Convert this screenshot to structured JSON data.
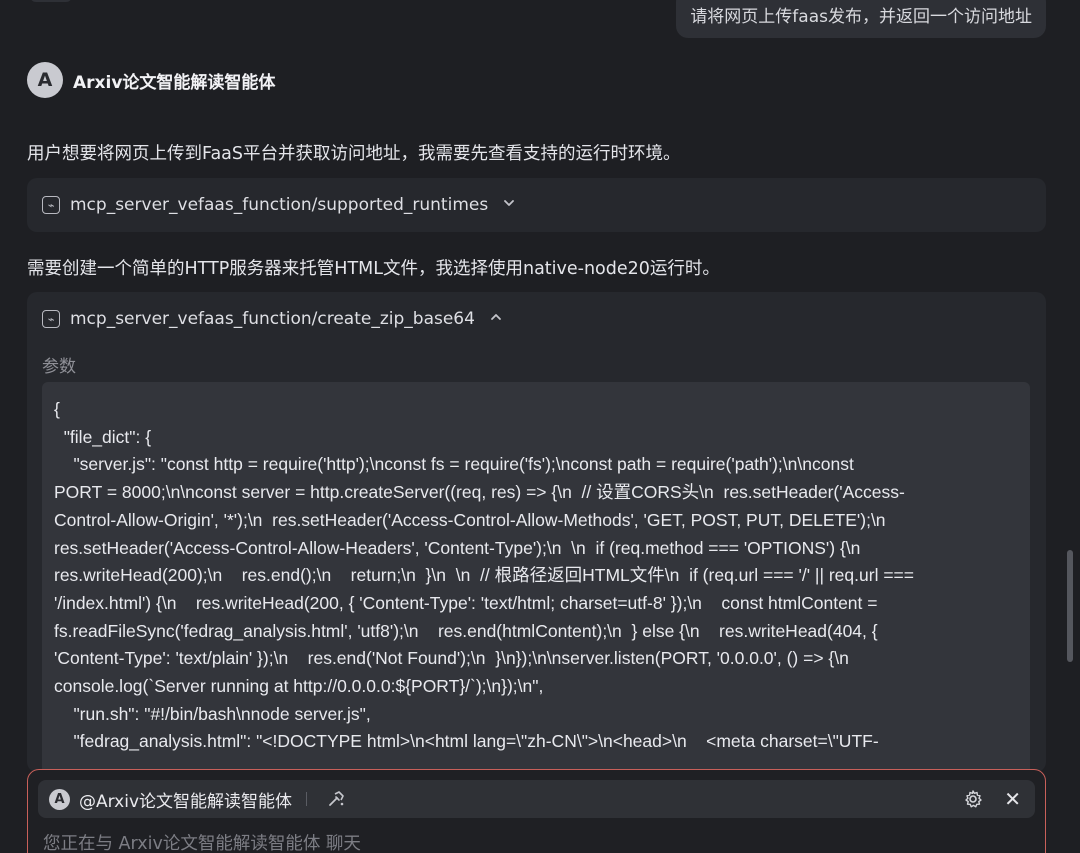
{
  "user_message": "请将网页上传faas发布，并返回一个访问地址",
  "agent": {
    "avatar_letter": "A",
    "name": "Arxiv论文智能解读智能体"
  },
  "messages": {
    "p1": "用户想要将网页上传到FaaS平台并获取访问地址，我需要先查看支持的运行时环境。",
    "p2": "需要创建一个简单的HTTP服务器来托管HTML文件，我选择使用native-node20运行时。"
  },
  "tools": [
    {
      "title": "mcp_server_vefaas_function/supported_runtimes",
      "chevron": "⌄"
    },
    {
      "title": "mcp_server_vefaas_function/create_zip_base64",
      "chevron": "⌃"
    }
  ],
  "params_label": "参数",
  "code_lines": [
    "{",
    "  \"file_dict\": {",
    "    \"server.js\": \"const http = require('http');\\nconst fs = require('fs');\\nconst path = require('path');\\n\\nconst",
    "PORT = 8000;\\n\\nconst server = http.createServer((req, res) => {\\n  // 设置CORS头\\n  res.setHeader('Access-",
    "Control-Allow-Origin', '*');\\n  res.setHeader('Access-Control-Allow-Methods', 'GET, POST, PUT, DELETE');\\n",
    "res.setHeader('Access-Control-Allow-Headers', 'Content-Type');\\n  \\n  if (req.method === 'OPTIONS') {\\n",
    "res.writeHead(200);\\n    res.end();\\n    return;\\n  }\\n  \\n  // 根路径返回HTML文件\\n  if (req.url === '/' || req.url ===",
    "'/index.html') {\\n    res.writeHead(200, { 'Content-Type': 'text/html; charset=utf-8' });\\n    const htmlContent =",
    "fs.readFileSync('fedrag_analysis.html', 'utf8');\\n    res.end(htmlContent);\\n  } else {\\n    res.writeHead(404, {",
    "'Content-Type': 'text/plain' });\\n    res.end('Not Found');\\n  }\\n});\\n\\nserver.listen(PORT, '0.0.0.0', () => {\\n",
    "console.log(`Server running at http://0.0.0.0:${PORT}/`);\\n});\\n\",",
    "    \"run.sh\": \"#!/bin/bash\\nnode server.js\",",
    "    \"fedrag_analysis.html\": \"<!DOCTYPE html>\\n<html lang=\\\"zh-CN\\\">\\n<head>\\n    <meta charset=\\\"UTF-"
  ],
  "input": {
    "mention": "@Arxiv论文智能解读智能体",
    "placeholder": "您正在与 Arxiv论文智能解读智能体 聊天",
    "close_glyph": "✕"
  },
  "icons": {
    "tool": "plugin-icon",
    "hammer": "hammer-icon",
    "gear": "gear-icon",
    "close": "close-icon"
  },
  "colors": {
    "background": "#1e1f23",
    "card": "#26282d",
    "code_bg": "#33353b",
    "input_border": "#c9605a"
  }
}
